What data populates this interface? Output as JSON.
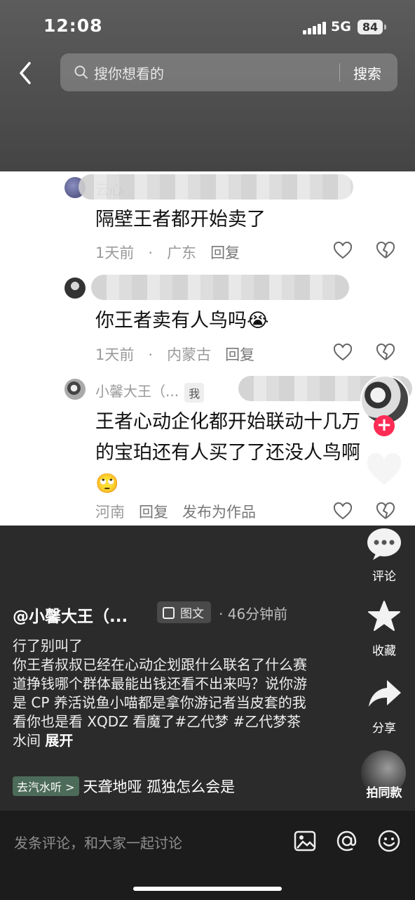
{
  "status_bar": {
    "time": "12:08",
    "network": "5G",
    "battery": "84"
  },
  "search": {
    "placeholder": "搜你想看的",
    "button": "搜索"
  },
  "comments": [
    {
      "username": "云心",
      "text": "隔壁王者都开始卖了",
      "time": "1天前",
      "location": "广东",
      "reply": "回复"
    },
    {
      "username": "",
      "text": "你王者卖有人鸟吗😭",
      "time": "1天前",
      "location": "内蒙古",
      "reply": "回复"
    },
    {
      "username": "小馨大王（...",
      "me_tag": "我",
      "text": "王者心动企化都开始联动十几万的宝珀还有人买了了还没人鸟啊🙄",
      "location": "河南",
      "reply": "回复",
      "publish": "发布为作品"
    }
  ],
  "right_rail": {
    "comment_label": "评论",
    "favorite_label": "收藏",
    "share_label": "分享",
    "same_label": "拍同款"
  },
  "post": {
    "author": "@小馨大王（...",
    "type_tag": "图文",
    "time_ago": "· 46分钟前",
    "description": "行了别叫了\n你王者叔叔已经在心动企划跟什么联名了什么赛道挣钱哪个群体最能出钱还看不出来吗？说你游是 CP 养活说鱼小喵都是拿你游记者当皮套的我看你也是看 XQDZ 看魔了#乙代梦 #乙代梦茶水间",
    "expand": "展开",
    "music_label": "去汽水听 >",
    "music_title": "天聋地哑 孤独怎么会是"
  },
  "comment_bar": {
    "placeholder": "发条评论，和大家一起讨论"
  },
  "colors": {
    "accent": "#fe2c55",
    "music_tag": "#4c6b59"
  }
}
